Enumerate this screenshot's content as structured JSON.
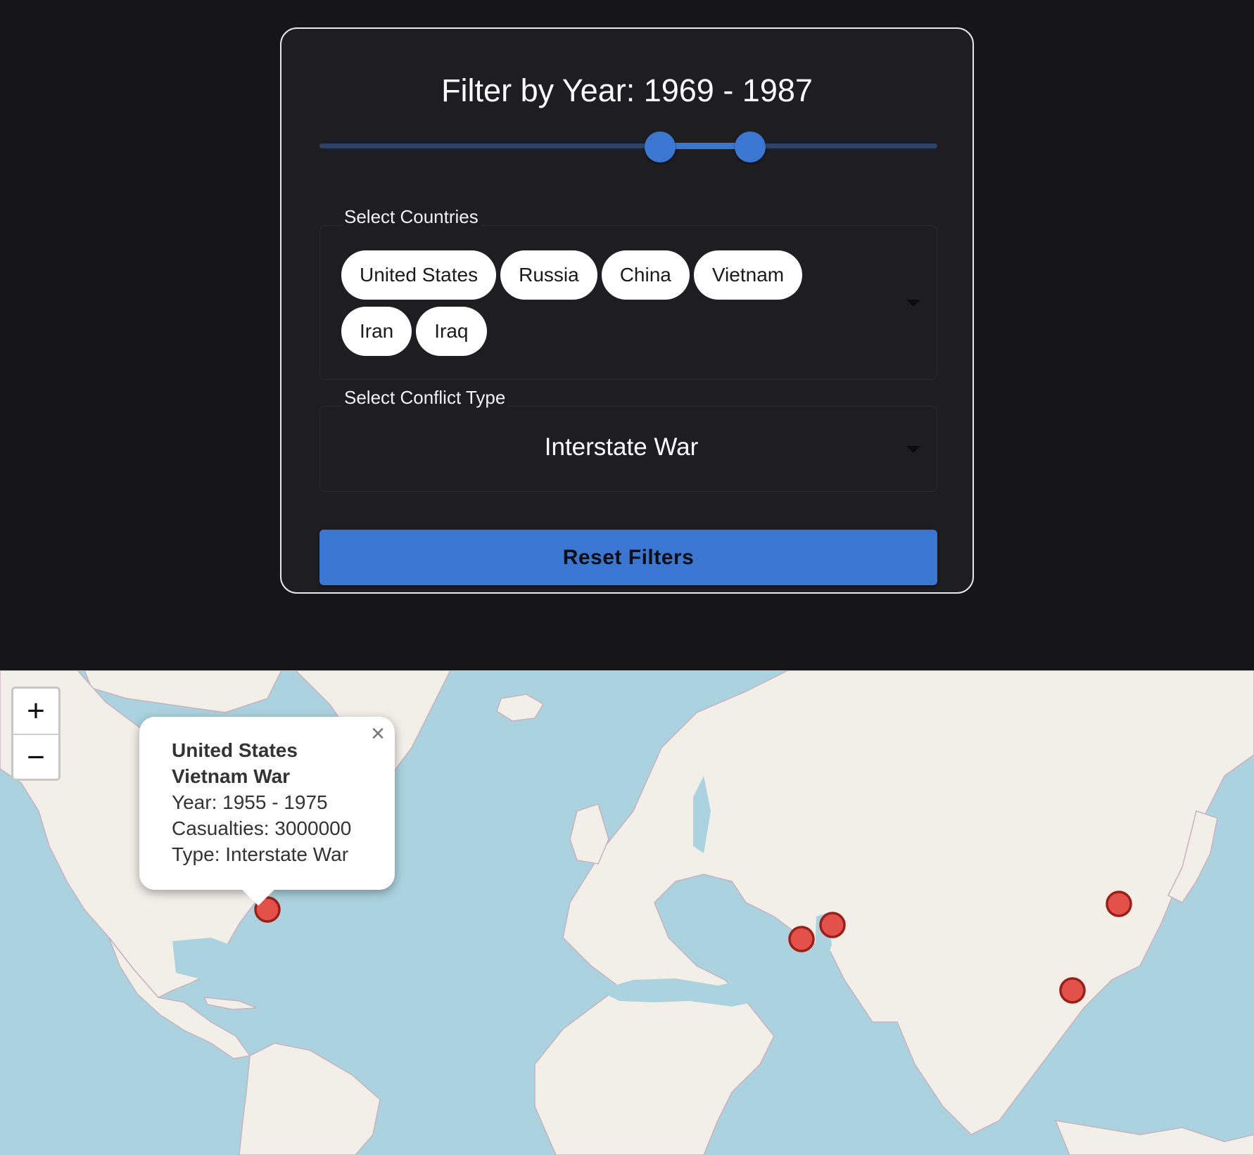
{
  "filters": {
    "year_title": "Filter by Year: 1969 - 1987",
    "year_range": {
      "start": 1969,
      "end": 1987
    },
    "countries_label": "Select Countries",
    "countries": [
      "United States",
      "Russia",
      "China",
      "Vietnam",
      "Iran",
      "Iraq"
    ],
    "conflict_label": "Select Conflict Type",
    "conflict_value": "Interstate War",
    "reset_label": "Reset Filters",
    "accent_color": "#3a77d2"
  },
  "map": {
    "zoom_in": "+",
    "zoom_out": "−",
    "marker_color": "#e2524a",
    "marker_count": 5,
    "popup": {
      "country": "United States",
      "conflict": "Vietnam War",
      "year_line": "Year: 1955 - 1975",
      "casualties_line": "Casualties: 3000000",
      "type_line": "Type: Interstate War",
      "close": "×"
    }
  }
}
